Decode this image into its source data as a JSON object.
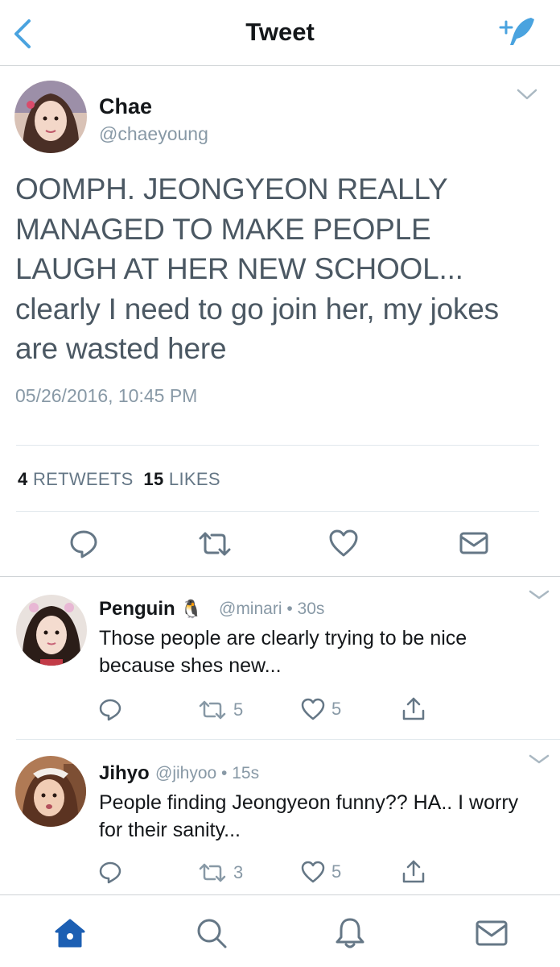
{
  "nav": {
    "title": "Tweet",
    "back_icon": "chevron-left-icon",
    "compose_icon": "compose-feather-icon",
    "accent": "#4aa3df"
  },
  "main_tweet": {
    "name": "Chae",
    "handle": "@chaeyoung",
    "text": "OOMPH. JEONGYEON REALLY\nMANAGED TO MAKE PEOPLE\nLAUGH AT HER NEW SCHOOL...\nclearly I need to go join her, my jokes\nare wasted here",
    "timestamp": "05/26/2016, 10:45 PM",
    "retweets_count": "4",
    "retweets_label": "RETWEETS",
    "likes_count": "15",
    "likes_label": "LIKES"
  },
  "replies": [
    {
      "name": "Penguin",
      "emoji": "🐧",
      "meta": "@minari • 30s",
      "text": "Those people are clearly trying to be nice because shes new...",
      "retweets": "5",
      "likes": "5"
    },
    {
      "name": "Jihyo",
      "meta": "@jihyoo • 15s",
      "text": "People finding Jeongyeon funny?? HA.. I worry for their sanity...",
      "retweets": "3",
      "likes": "5"
    }
  ],
  "tabbar": {
    "items": [
      "home-icon",
      "search-icon",
      "notifications-bell-icon",
      "messages-envelope-icon"
    ],
    "active_color": "#1c5fb3",
    "inactive_color": "#657786"
  }
}
